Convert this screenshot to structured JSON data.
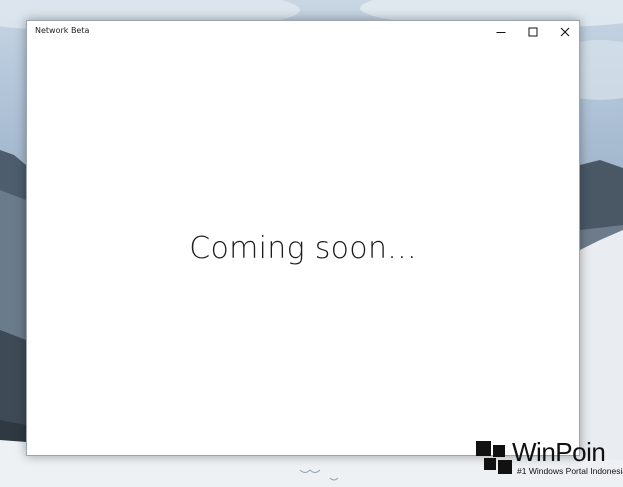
{
  "window": {
    "title": "Network Beta",
    "controls": {
      "minimize_icon": "minimize-icon",
      "maximize_icon": "maximize-icon",
      "close_icon": "close-icon"
    }
  },
  "content": {
    "message": "Coming soon..."
  },
  "watermark": {
    "brand": "WinPoin",
    "tagline": "#1 Windows Portal Indonesia"
  },
  "colors": {
    "window_background": "#ffffff",
    "text": "#1c1c1c"
  }
}
